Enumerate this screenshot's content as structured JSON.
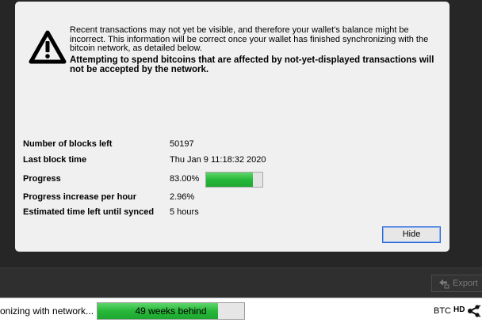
{
  "modal": {
    "warning_text": "Recent transactions may not yet be visible, and therefore your wallet's balance might be incorrect. This information will be correct once your wallet has finished synchronizing with the bitcoin network, as detailed below.",
    "warning_bold": "Attempting to spend bitcoins that are affected by not-yet-displayed transactions will not be accepted by the network.",
    "rows": {
      "blocks_left": {
        "label": "Number of blocks left",
        "value": "50197"
      },
      "last_block_time": {
        "label": "Last block time",
        "value": "Thu Jan 9 11:18:32 2020"
      },
      "progress": {
        "label": "Progress",
        "value": "83.00%",
        "fraction": 0.83
      },
      "progress_rate": {
        "label": "Progress increase per hour",
        "value": "2.96%"
      },
      "time_left": {
        "label": "Estimated time left until synced",
        "value": "5 hours"
      }
    },
    "hide_label": "Hide"
  },
  "toolbar": {
    "export_label": "Export"
  },
  "status_bar": {
    "sync_text": "onizing with network...",
    "progress_label": "49 weeks behind",
    "progress_fraction": 0.82,
    "unit": "BTC",
    "hd_label": "HD"
  },
  "colors": {
    "progress_green": "#28b83a",
    "focus_blue": "#2a6ad8"
  }
}
